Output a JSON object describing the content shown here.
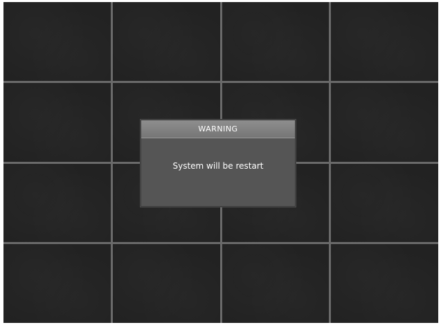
{
  "dialog": {
    "title": "WARNING",
    "message": "System will be restart"
  },
  "camera_grid": {
    "rows": 4,
    "columns": 4
  }
}
